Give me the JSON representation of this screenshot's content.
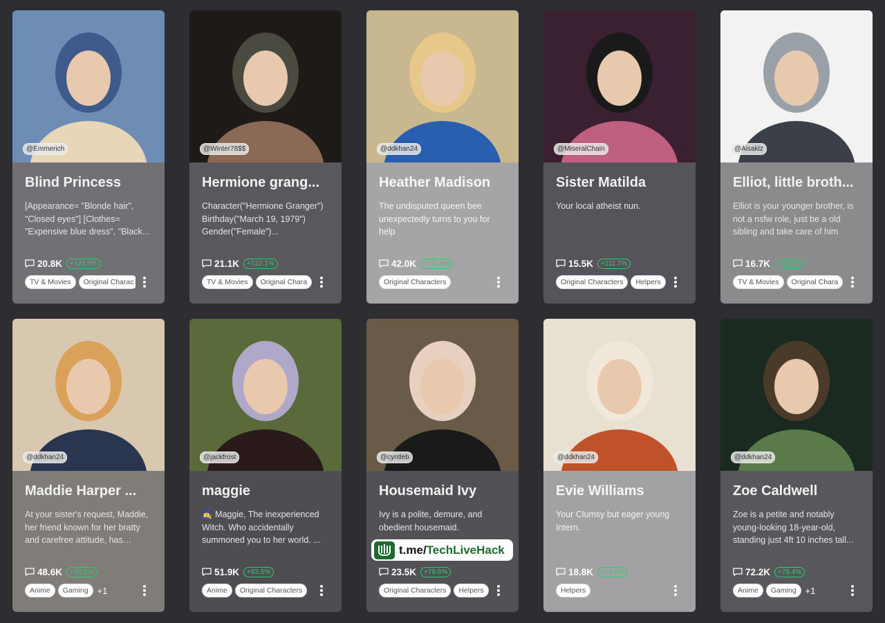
{
  "cards": [
    {
      "name": "Blind Princess",
      "handle": "@Emmerich",
      "desc": "[Appearance= \"Blonde hair\", \"Closed eyes\"] [Clothes= \"Expensive blue dress\", \"Black…",
      "count": "20.8K",
      "growth": "+122.9%",
      "tags": [
        "TV & Movies",
        "Original Charac"
      ],
      "extra": "",
      "bg": "#707075",
      "img": [
        "#6e8db5",
        "#e8d6b8",
        "#3d5a8a"
      ]
    },
    {
      "name": "Hermione grang...",
      "handle": "@Winter78$$",
      "desc": "Character(\"Hermione Granger\") Birthday(\"March 19, 1979\") Gender(\"Female\")...",
      "count": "21.1K",
      "growth": "+122.1%",
      "tags": [
        "TV & Movies",
        "Original Chara"
      ],
      "extra": "",
      "bg": "#59595d",
      "img": [
        "#1e1a17",
        "#8a6a55",
        "#4a4a40"
      ]
    },
    {
      "name": "Heather Madison",
      "handle": "@ddkhan24",
      "desc": "The undisputed queen bee unexpectedly turns to you for help",
      "count": "42.0K",
      "growth": "+111.9%",
      "tags": [
        "Original Characters"
      ],
      "extra": "",
      "bg": "#a5a5a7",
      "img": [
        "#c9b78f",
        "#2a5fb0",
        "#e8c88a"
      ]
    },
    {
      "name": "Sister Matilda",
      "handle": "@MiseralChain",
      "desc": "Your local atheist nun.",
      "count": "15.5K",
      "growth": "+111.7%",
      "tags": [
        "Original Characters",
        "Helpers"
      ],
      "extra": "",
      "bg": "#56545a",
      "img": [
        "#3a2030",
        "#c06080",
        "#1a1a1a"
      ]
    },
    {
      "name": "Elliot, little broth...",
      "handle": "@Aisaklz",
      "desc": "Elliot is your younger brother, is not a nsfw role, just be a old sibling and take care of him",
      "count": "16.7K",
      "growth": "+95.9%",
      "tags": [
        "TV & Movies",
        "Original Chara"
      ],
      "extra": "",
      "bg": "#8b8b8e",
      "img": [
        "#f2f2f2",
        "#3a3f48",
        "#9aa0a8"
      ]
    },
    {
      "name": "Maddie Harper ...",
      "handle": "@ddkhan24",
      "desc": "At your sister's request, Maddie, her friend known for her bratty and carefree attitude, has…",
      "count": "48.6K",
      "growth": "+83.8%",
      "tags": [
        "Anime",
        "Gaming"
      ],
      "extra": "+1",
      "bg": "#807c78",
      "img": [
        "#d8c8b0",
        "#2a3550",
        "#d9a15a"
      ]
    },
    {
      "name": "maggie",
      "handle": "@jackfrost",
      "desc": "🧙‍♀️ Maggie, The inexperienced Witch. Who accidentally summoned you to her world. ...",
      "count": "51.9K",
      "growth": "+83.5%",
      "tags": [
        "Anime",
        "Original Characters"
      ],
      "extra": "",
      "bg": "#4e4e52",
      "img": [
        "#5a6a3a",
        "#2a1a1a",
        "#b0a8c8"
      ]
    },
    {
      "name": "Housemaid Ivy",
      "handle": "@cyntleb",
      "desc": "Ivy is a polite, demure, and obedient housemaid.",
      "count": "23.5K",
      "growth": "+79.6%",
      "tags": [
        "Original Characters",
        "Helpers"
      ],
      "extra": "",
      "bg": "#525256",
      "img": [
        "#6a5a48",
        "#1a1a1a",
        "#e8d0c0"
      ]
    },
    {
      "name": "Evie Williams",
      "handle": "@ddkhan24",
      "desc": "Your Clumsy but eager young Intern.",
      "count": "18.8K",
      "growth": "+78.4%",
      "tags": [
        "Helpers"
      ],
      "extra": "",
      "bg": "#a2a2a4",
      "img": [
        "#e8e0d0",
        "#c0522a",
        "#f0e8d8"
      ]
    },
    {
      "name": "Zoe Caldwell",
      "handle": "@ddkhan24",
      "desc": "Zoe is a petite and notably young-looking 18-year-old, standing just 4ft 10 inches tall...",
      "count": "72.2K",
      "growth": "+78.4%",
      "tags": [
        "Anime",
        "Gaming"
      ],
      "extra": "+1",
      "bg": "#58585c",
      "img": [
        "#1a2a20",
        "#5a7a4a",
        "#4a3a2a"
      ]
    }
  ],
  "watermark": {
    "prefix": "t.me/",
    "brand": "TechLiveHack"
  },
  "colors": {
    "page_bg": "#2d2d32",
    "growth_green": "#2ecc71"
  }
}
